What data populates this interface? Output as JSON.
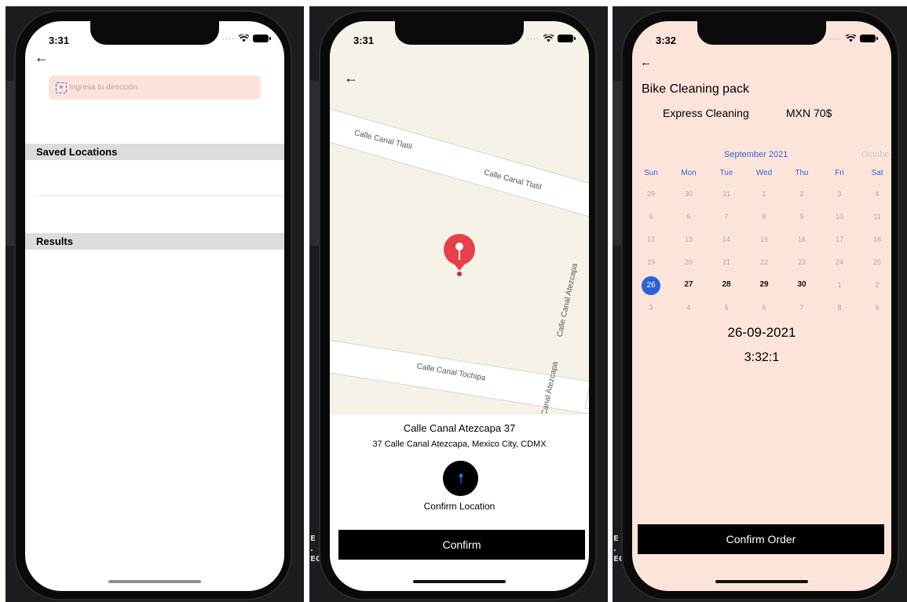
{
  "status": {
    "screen1_time": "3:31",
    "screen2_time": "3:31",
    "screen3_time": "3:32"
  },
  "background_glyphs": {
    "panel2": "E\n.\nEO.",
    "panel3": "E\n.\nEO."
  },
  "screen1": {
    "search_placeholder": "Ingresa tu dirección",
    "saved_locations_header": "Saved Locations",
    "results_header": "Results"
  },
  "screen2": {
    "streets": [
      "Calle Canal Tlatil",
      "Calle Canal Tlatil",
      "Calle Canal Atezcapa",
      "Calle Canal Tochipa",
      "Calle Canal Atezcapa"
    ],
    "address_title": "Calle Canal Atezcapa 37",
    "address_subtitle": "37 Calle Canal Atezcapa, Mexico City, CDMX",
    "confirm_location_label": "Confirm Location",
    "confirm_button": "Confirm",
    "pin_color": "#e8404a"
  },
  "screen3": {
    "pack_title": "Bike Cleaning pack",
    "service_name": "Express Cleaning",
    "service_price": "MXN 70$",
    "month_label": "September 2021",
    "next_month_label": "Octobe",
    "weekdays": [
      "Sun",
      "Mon",
      "Tue",
      "Wed",
      "Thu",
      "Fri",
      "Sat"
    ],
    "weeks": [
      [
        "29",
        "30",
        "31",
        "1",
        "2",
        "3",
        "4"
      ],
      [
        "5",
        "6",
        "7",
        "8",
        "9",
        "10",
        "11"
      ],
      [
        "12",
        "13",
        "14",
        "15",
        "16",
        "17",
        "18"
      ],
      [
        "19",
        "20",
        "21",
        "22",
        "23",
        "24",
        "25"
      ],
      [
        "26",
        "27",
        "28",
        "29",
        "30",
        "1",
        "2"
      ],
      [
        "3",
        "4",
        "5",
        "6",
        "7",
        "8",
        "9"
      ]
    ],
    "selected_day": "26",
    "selected_date": "26-09-2021",
    "selected_time": "3:32:1",
    "confirm_order_button": "Confirm Order",
    "accent_color": "#2a63d8",
    "background_color": "#fde4db"
  }
}
